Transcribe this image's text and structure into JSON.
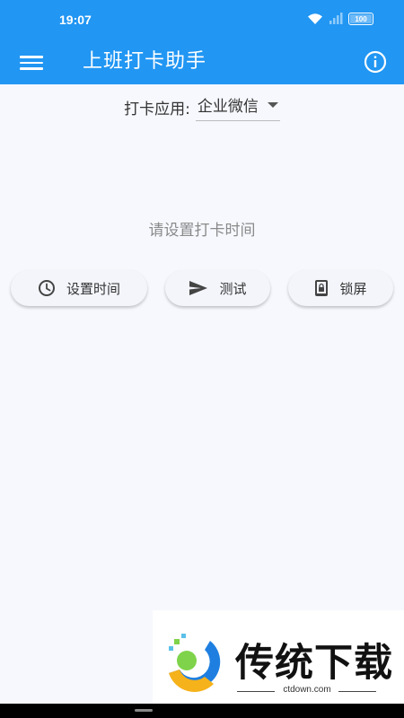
{
  "status_bar": {
    "time": "19:07",
    "battery": "100",
    "icons": [
      "wifi-icon",
      "signal-icon",
      "battery-icon"
    ]
  },
  "app_bar": {
    "title": "上班打卡助手",
    "icons": [
      "menu-icon",
      "info-icon"
    ],
    "color": "#2196f3"
  },
  "app_select": {
    "label": "打卡应用:",
    "value": "企业微信"
  },
  "main": {
    "empty_message": "请设置打卡时间"
  },
  "actions": {
    "set_time": {
      "label": "设置时间",
      "icon": "clock-icon"
    },
    "test": {
      "label": "测试",
      "icon": "send-icon"
    },
    "lock": {
      "label": "锁屏",
      "icon": "lock-screen-icon"
    }
  },
  "watermark": {
    "name": "传统下载",
    "url": "ctdown.com"
  }
}
